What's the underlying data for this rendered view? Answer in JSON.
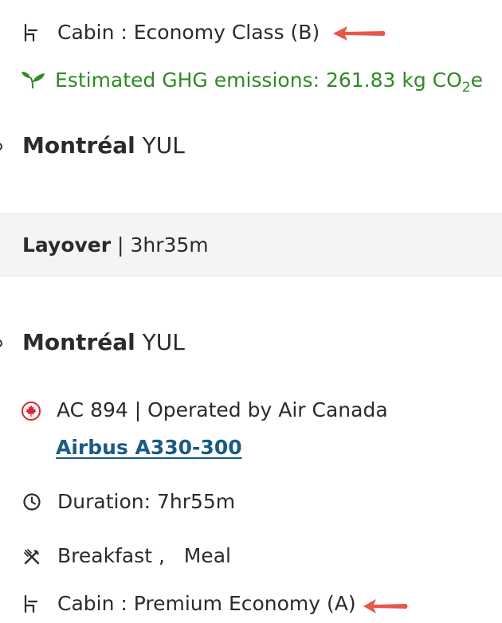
{
  "segment1": {
    "cabin_label": "Cabin : Economy Class (B)",
    "emissions_prefix": "Estimated GHG emissions: 261.83 kg CO",
    "emissions_sub": "2",
    "emissions_suffix": "e"
  },
  "arrival1": {
    "city": "Montréal",
    "code": "YUL"
  },
  "layover": {
    "label": "Layover",
    "separator": "|",
    "duration": "3hr35m"
  },
  "departure2": {
    "city": "Montréal",
    "code": "YUL"
  },
  "flight2": {
    "flight_info": "AC 894 | Operated by Air Canada",
    "aircraft": "Airbus A330-300",
    "duration": "Duration: 7hr55m",
    "meals": "Breakfast ,   Meal",
    "cabin_label": "Cabin : Premium Economy (A)"
  },
  "colors": {
    "emissions_green": "#2e8b22",
    "link_blue": "#1a5a86",
    "annotation_arrow": "#e8574a",
    "air_canada_red": "#d8292f"
  },
  "icons": {
    "seat": "seat-icon",
    "leaf": "leaf-icon",
    "maple_leaf": "air-canada-logo-icon",
    "clock": "clock-icon",
    "meal": "fork-knife-icon",
    "arrow": "annotation-arrow-icon"
  }
}
